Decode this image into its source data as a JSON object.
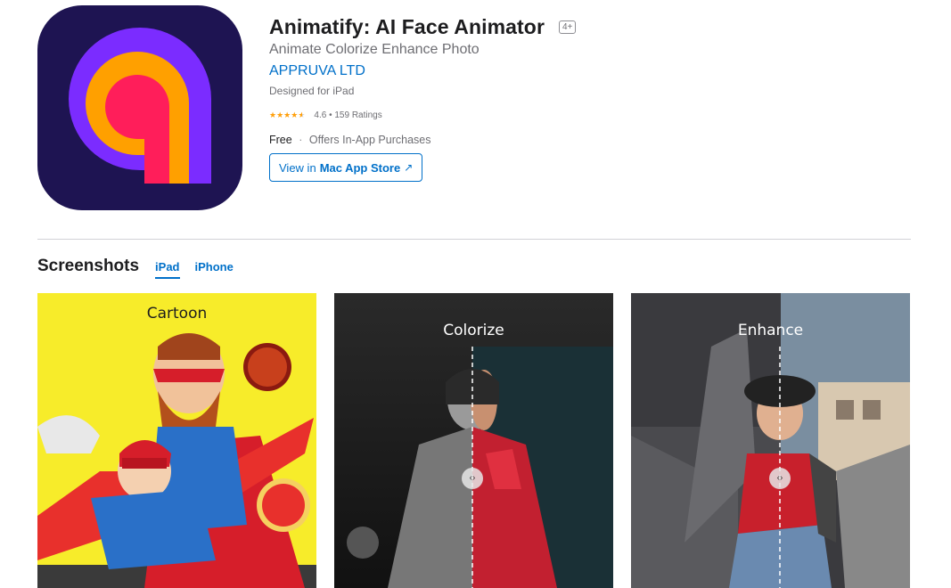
{
  "app": {
    "title": "Animatify: AI Face Animator",
    "age_rating": "4+",
    "subtitle": "Animate Colorize Enhance Photo",
    "developer": "APPRUVA LTD",
    "designed_for": "Designed for iPad",
    "rating": "4.6",
    "rating_value": 4.6,
    "ratings_count": "159 Ratings",
    "price": "Free",
    "iap": "Offers In-App Purchases",
    "store_button_prefix": "View in",
    "store_button_strong": "Mac App Store",
    "store_button_icon": "↗"
  },
  "screenshots": {
    "title": "Screenshots",
    "tabs": [
      {
        "label": "iPad",
        "active": true
      },
      {
        "label": "iPhone",
        "active": false
      }
    ],
    "items": [
      {
        "label": "Cartoon"
      },
      {
        "label": "Colorize"
      },
      {
        "label": "Enhance"
      }
    ],
    "slider_icon": "‹›"
  },
  "colors": {
    "link": "#0070c9",
    "star": "#ff9f0a",
    "icon_bg": "#1e1452",
    "icon_purple": "#7b2cff",
    "icon_orange": "#ffa000",
    "icon_pink": "#ff1e5a"
  }
}
